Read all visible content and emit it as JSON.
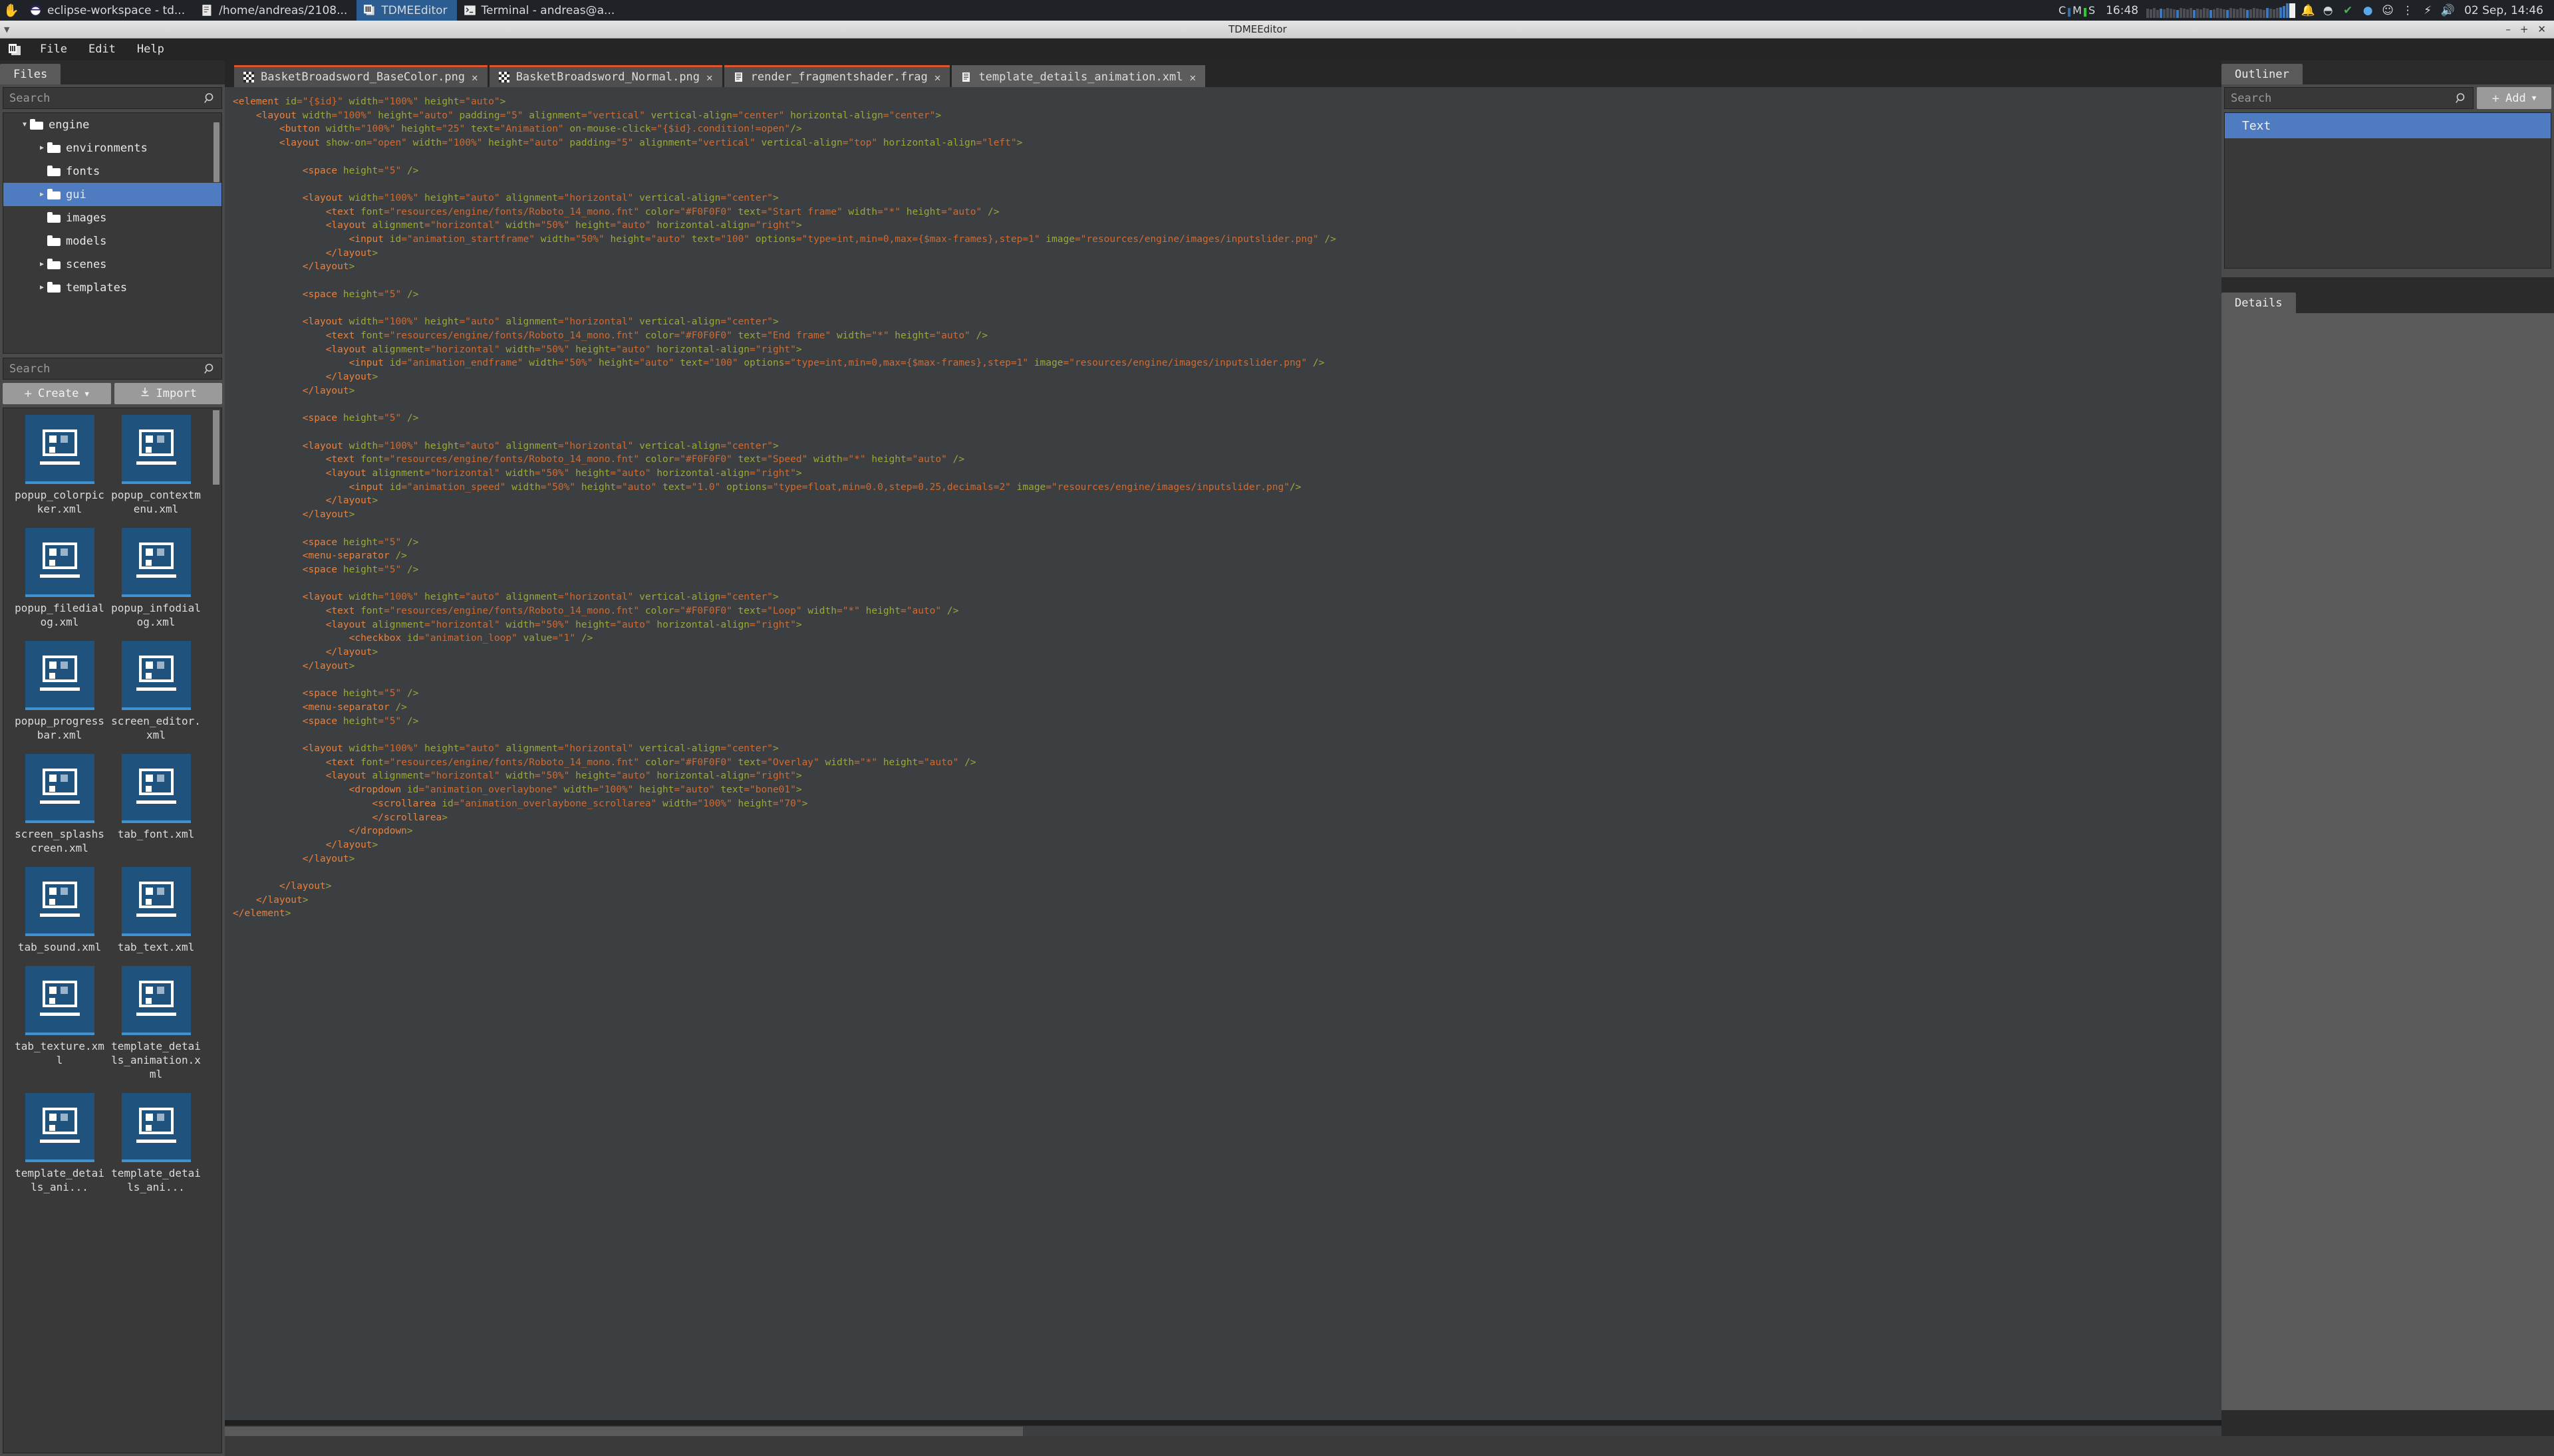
{
  "os_taskbar": {
    "hand_icon": "hand-icon",
    "tasks": [
      {
        "label": "eclipse-workspace - td...",
        "icon": "eclipse-icon",
        "active": false
      },
      {
        "label": "/home/andreas/2108...",
        "icon": "text-editor-icon",
        "active": false
      },
      {
        "label": "TDMEEditor",
        "icon": "tdme-icon",
        "active": true
      },
      {
        "label": "Terminal - andreas@a...",
        "icon": "terminal-icon",
        "active": false
      }
    ],
    "tray": {
      "cms": [
        "C",
        "M",
        "S"
      ],
      "clock": "16:48",
      "icons": [
        "bell-icon",
        "bluetooth-icon",
        "shield-check-icon",
        "blue-circle-icon",
        "discord-icon",
        "network-icon",
        "power-icon",
        "volume-icon"
      ],
      "date": "02 Sep, 14:46"
    }
  },
  "window": {
    "title": "TDMEEditor",
    "buttons": [
      "minimize-button",
      "maximize-button",
      "close-button"
    ]
  },
  "menubar": {
    "logo": "tdme-logo-icon",
    "items": [
      "File",
      "Edit",
      "Help"
    ]
  },
  "left_panel": {
    "tab_label": "Files",
    "tree_search": {
      "placeholder": "Search",
      "value": ""
    },
    "tree": [
      {
        "label": "engine",
        "indent": 0,
        "twisty": "down",
        "selected": false
      },
      {
        "label": "environments",
        "indent": 1,
        "twisty": "right",
        "selected": false
      },
      {
        "label": "fonts",
        "indent": 1,
        "twisty": "none",
        "selected": false
      },
      {
        "label": "gui",
        "indent": 1,
        "twisty": "right",
        "selected": true
      },
      {
        "label": "images",
        "indent": 1,
        "twisty": "none",
        "selected": false
      },
      {
        "label": "models",
        "indent": 1,
        "twisty": "none",
        "selected": false
      },
      {
        "label": "scenes",
        "indent": 1,
        "twisty": "right",
        "selected": false
      },
      {
        "label": "templates",
        "indent": 1,
        "twisty": "right",
        "selected": false
      }
    ],
    "grid_search": {
      "placeholder": "Search",
      "value": ""
    },
    "create_button": {
      "label": "Create",
      "plus": "+",
      "caret": "▼"
    },
    "import_button": {
      "label": "Import",
      "icon": "download-icon"
    },
    "files": [
      "popup_colorpicker.xml",
      "popup_contextmenu.xml",
      "popup_filedialog.xml",
      "popup_infodialog.xml",
      "popup_progressbar.xml",
      "screen_editor.xml",
      "screen_splashscreen.xml",
      "tab_font.xml",
      "tab_sound.xml",
      "tab_text.xml",
      "tab_texture.xml",
      "template_details_animation.xml",
      "template_details_ani...",
      "template_details_ani..."
    ]
  },
  "editor": {
    "tabs": [
      {
        "label": "BasketBroadsword_BaseColor.png",
        "icon": "image-file-icon",
        "close": "✕",
        "active": false
      },
      {
        "label": "BasketBroadsword_Normal.png",
        "icon": "image-file-icon",
        "close": "✕",
        "active": false
      },
      {
        "label": "render_fragmentshader.frag",
        "icon": "text-file-icon",
        "close": "✕",
        "active": false
      },
      {
        "label": "template_details_animation.xml",
        "icon": "text-file-icon",
        "close": "✕",
        "active": true
      }
    ],
    "code": "<element id=\"{$id}\" width=\"100%\" height=\"auto\">\n\t<layout width=\"100%\" height=\"auto\" padding=\"5\" alignment=\"vertical\" vertical-align=\"center\" horizontal-align=\"center\">\n\t\t<button width=\"100%\" height=\"25\" text=\"Animation\" on-mouse-click=\"{$id}.condition!=open\"/>\n\t\t<layout show-on=\"open\" width=\"100%\" height=\"auto\" padding=\"5\" alignment=\"vertical\" vertical-align=\"top\" horizontal-align=\"left\">\n\n\t\t\t<space height=\"5\" />\n\n\t\t\t<layout width=\"100%\" height=\"auto\" alignment=\"horizontal\" vertical-align=\"center\">\n\t\t\t\t<text font=\"resources/engine/fonts/Roboto_14_mono.fnt\" color=\"#F0F0F0\" text=\"Start frame\" width=\"*\" height=\"auto\" />\n\t\t\t\t<layout alignment=\"horizontal\" width=\"50%\" height=\"auto\" horizontal-align=\"right\">\n\t\t\t\t\t<input id=\"animation_startframe\" width=\"50%\" height=\"auto\" text=\"100\" options=\"type=int,min=0,max={$max-frames},step=1\" image=\"resources/engine/images/inputslider.png\" />\n\t\t\t\t</layout>\n\t\t\t</layout>\n\n\t\t\t<space height=\"5\" />\n\n\t\t\t<layout width=\"100%\" height=\"auto\" alignment=\"horizontal\" vertical-align=\"center\">\n\t\t\t\t<text font=\"resources/engine/fonts/Roboto_14_mono.fnt\" color=\"#F0F0F0\" text=\"End frame\" width=\"*\" height=\"auto\" />\n\t\t\t\t<layout alignment=\"horizontal\" width=\"50%\" height=\"auto\" horizontal-align=\"right\">\n\t\t\t\t\t<input id=\"animation_endframe\" width=\"50%\" height=\"auto\" text=\"100\" options=\"type=int,min=0,max={$max-frames},step=1\" image=\"resources/engine/images/inputslider.png\" />\n\t\t\t\t</layout>\n\t\t\t</layout>\n\n\t\t\t<space height=\"5\" />\n\n\t\t\t<layout width=\"100%\" height=\"auto\" alignment=\"horizontal\" vertical-align=\"center\">\n\t\t\t\t<text font=\"resources/engine/fonts/Roboto_14_mono.fnt\" color=\"#F0F0F0\" text=\"Speed\" width=\"*\" height=\"auto\" />\n\t\t\t\t<layout alignment=\"horizontal\" width=\"50%\" height=\"auto\" horizontal-align=\"right\">\n\t\t\t\t\t<input id=\"animation_speed\" width=\"50%\" height=\"auto\" text=\"1.0\" options=\"type=float,min=0.0,step=0.25,decimals=2\" image=\"resources/engine/images/inputslider.png\"/>\n\t\t\t\t</layout>\n\t\t\t</layout>\n\n\t\t\t<space height=\"5\" />\n\t\t\t<menu-separator />\n\t\t\t<space height=\"5\" />\n\n\t\t\t<layout width=\"100%\" height=\"auto\" alignment=\"horizontal\" vertical-align=\"center\">\n\t\t\t\t<text font=\"resources/engine/fonts/Roboto_14_mono.fnt\" color=\"#F0F0F0\" text=\"Loop\" width=\"*\" height=\"auto\" />\n\t\t\t\t<layout alignment=\"horizontal\" width=\"50%\" height=\"auto\" horizontal-align=\"right\">\n\t\t\t\t\t<checkbox id=\"animation_loop\" value=\"1\" />\n\t\t\t\t</layout>\n\t\t\t</layout>\n\n\t\t\t<space height=\"5\" />\n\t\t\t<menu-separator />\n\t\t\t<space height=\"5\" />\n\n\t\t\t<layout width=\"100%\" height=\"auto\" alignment=\"horizontal\" vertical-align=\"center\">\n\t\t\t\t<text font=\"resources/engine/fonts/Roboto_14_mono.fnt\" color=\"#F0F0F0\" text=\"Overlay\" width=\"*\" height=\"auto\" />\n\t\t\t\t<layout alignment=\"horizontal\" width=\"50%\" height=\"auto\" horizontal-align=\"right\">\n\t\t\t\t\t<dropdown id=\"animation_overlaybone\" width=\"100%\" height=\"auto\" text=\"bone01\">\n\t\t\t\t\t\t<scrollarea id=\"animation_overlaybone_scrollarea\" width=\"100%\" height=\"70\">\n\t\t\t\t\t\t</scrollarea>\n\t\t\t\t\t</dropdown>\n\t\t\t\t</layout>\n\t\t\t</layout>\n\n\t\t</layout>\n\t</layout>\n</element>"
  },
  "right_panel": {
    "outliner": {
      "tab_label": "Outliner",
      "search": {
        "placeholder": "Search",
        "value": ""
      },
      "add_button": {
        "label": "Add",
        "plus": "+",
        "caret": "▼"
      },
      "items": [
        {
          "label": "Text",
          "selected": true
        }
      ]
    },
    "details": {
      "tab_label": "Details"
    }
  },
  "colors": {
    "accent_selection": "#4f7cc0",
    "tab_accent": "#e2532a",
    "thumb_blue": "#1f527d",
    "thumb_underline": "#3f91cf",
    "panel_bg": "#2b2b2b",
    "code_bg": "#3c3f41"
  }
}
